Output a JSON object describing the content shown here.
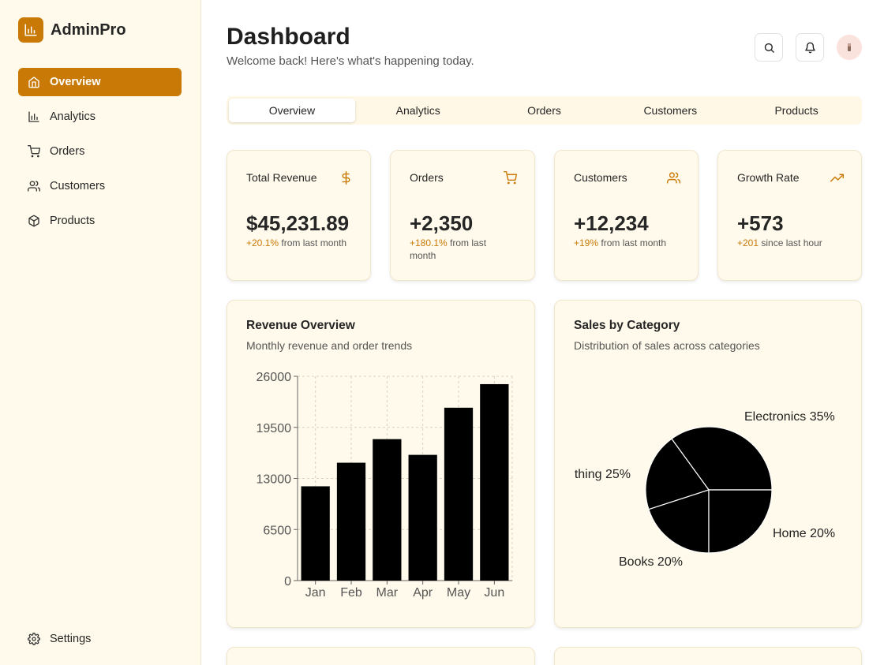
{
  "app": {
    "name": "AdminPro"
  },
  "colors": {
    "accent": "#c97a06",
    "sidebar_bg": "#fffaeb",
    "card_bg": "#fffaeb"
  },
  "sidebar": {
    "items": [
      {
        "label": "Overview",
        "icon": "home-icon",
        "active": true
      },
      {
        "label": "Analytics",
        "icon": "bar-chart-icon"
      },
      {
        "label": "Orders",
        "icon": "cart-icon"
      },
      {
        "label": "Customers",
        "icon": "users-icon"
      },
      {
        "label": "Products",
        "icon": "box-icon"
      }
    ],
    "settings": {
      "label": "Settings",
      "icon": "gear-icon"
    }
  },
  "header": {
    "title": "Dashboard",
    "subtitle": "Welcome back! Here's what's happening today.",
    "icons": [
      "search-icon",
      "bell-icon",
      "avatar"
    ]
  },
  "tabs": [
    {
      "label": "Overview",
      "active": true
    },
    {
      "label": "Analytics"
    },
    {
      "label": "Orders"
    },
    {
      "label": "Customers"
    },
    {
      "label": "Products"
    }
  ],
  "stats": [
    {
      "label": "Total Revenue",
      "value": "$45,231.89",
      "change": "+20.1%",
      "change_text": " from last month",
      "icon": "dollar-icon"
    },
    {
      "label": "Orders",
      "value": "+2,350",
      "change": "+180.1%",
      "change_text": " from last month",
      "icon": "cart-icon"
    },
    {
      "label": "Customers",
      "value": "+12,234",
      "change": "+19%",
      "change_text": " from last month",
      "icon": "users-icon"
    },
    {
      "label": "Growth Rate",
      "value": "+573",
      "change": "+201",
      "change_text": " since last hour",
      "icon": "trending-up-icon"
    }
  ],
  "revenue_card": {
    "title": "Revenue Overview",
    "subtitle": "Monthly revenue and order trends"
  },
  "sales_card": {
    "title": "Sales by Category",
    "subtitle": "Distribution of sales across categories"
  },
  "chart_data": [
    {
      "type": "bar",
      "categories": [
        "Jan",
        "Feb",
        "Mar",
        "Apr",
        "May",
        "Jun"
      ],
      "values": [
        12000,
        15000,
        18000,
        16000,
        22000,
        25000
      ],
      "ylim": [
        0,
        26000
      ],
      "yticks": [
        "0",
        "6500",
        "13000",
        "19500",
        "26000"
      ],
      "grid": true,
      "color": "#000000"
    },
    {
      "type": "pie",
      "slices": [
        {
          "name": "Electronics",
          "value": 35,
          "label": "Electronics 35%"
        },
        {
          "name": "Home",
          "value": 20,
          "label": "Home 20%"
        },
        {
          "name": "Books",
          "value": 20,
          "label": "Books 20%"
        },
        {
          "name": "Clothing",
          "value": 25,
          "label": "thing 25%"
        }
      ],
      "color": "#000000"
    }
  ]
}
